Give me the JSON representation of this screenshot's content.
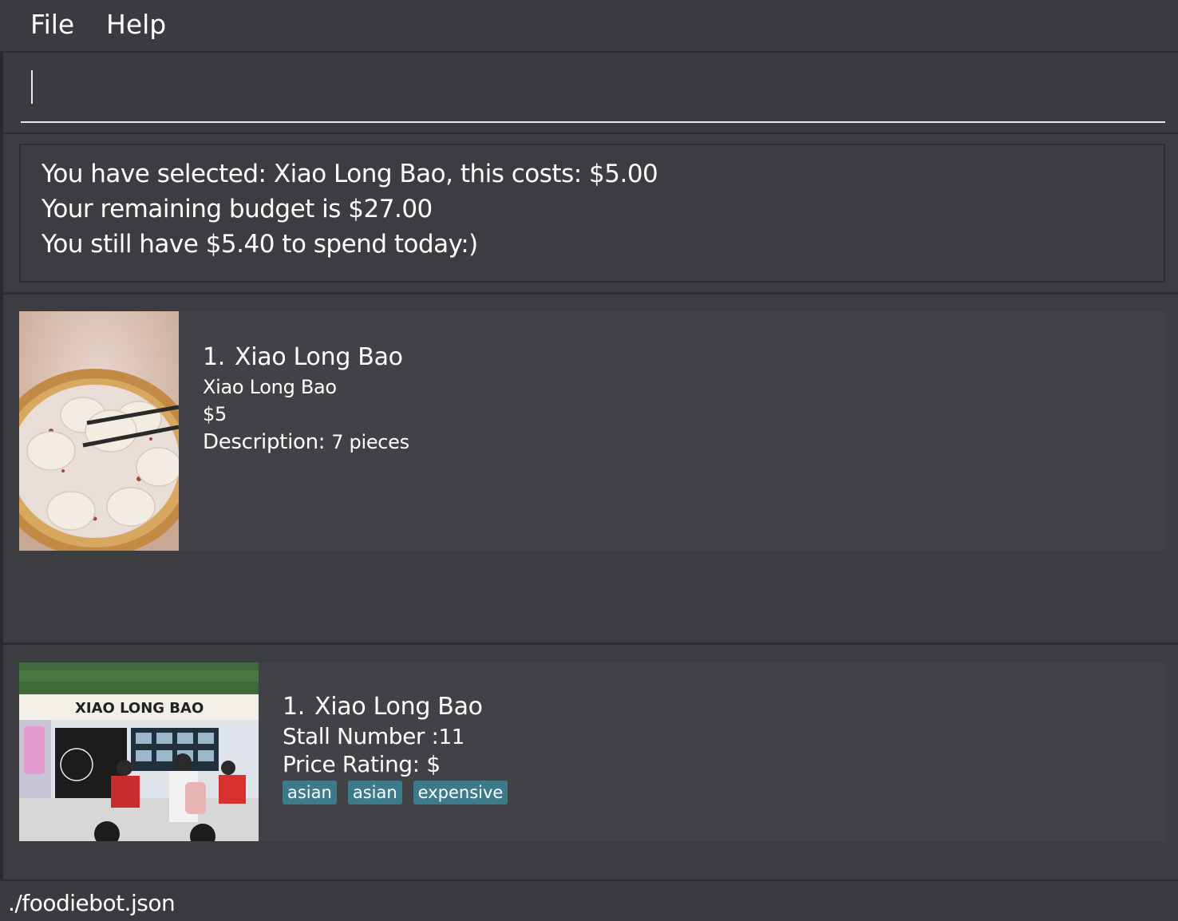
{
  "menu": {
    "file_label": "File",
    "help_label": "Help"
  },
  "command": {
    "value": ""
  },
  "result": {
    "lines": [
      "You have selected: Xiao Long Bao, this costs: $5.00",
      "Your remaining budget is $27.00",
      "You still have $5.40 to spend today:)"
    ]
  },
  "dish": {
    "index": "1.",
    "name": "Xiao Long Bao",
    "stall_name": "Xiao Long Bao",
    "price": "$5",
    "description_label": "Description:",
    "description_value": "7 pieces"
  },
  "stall": {
    "index": "1.",
    "name": "Xiao Long Bao",
    "stall_number_label": "Stall Number :",
    "stall_number_value": "11",
    "price_rating_label": "Price Rating:",
    "price_rating_value": "$",
    "tags": [
      "asian",
      "asian",
      "expensive"
    ],
    "sign_text": "XIAO LONG BAO"
  },
  "status": {
    "file_path": "./foodiebot.json"
  },
  "colors": {
    "background": "#3c3d40",
    "card": "#414245",
    "tag": "#3d7a8c"
  }
}
